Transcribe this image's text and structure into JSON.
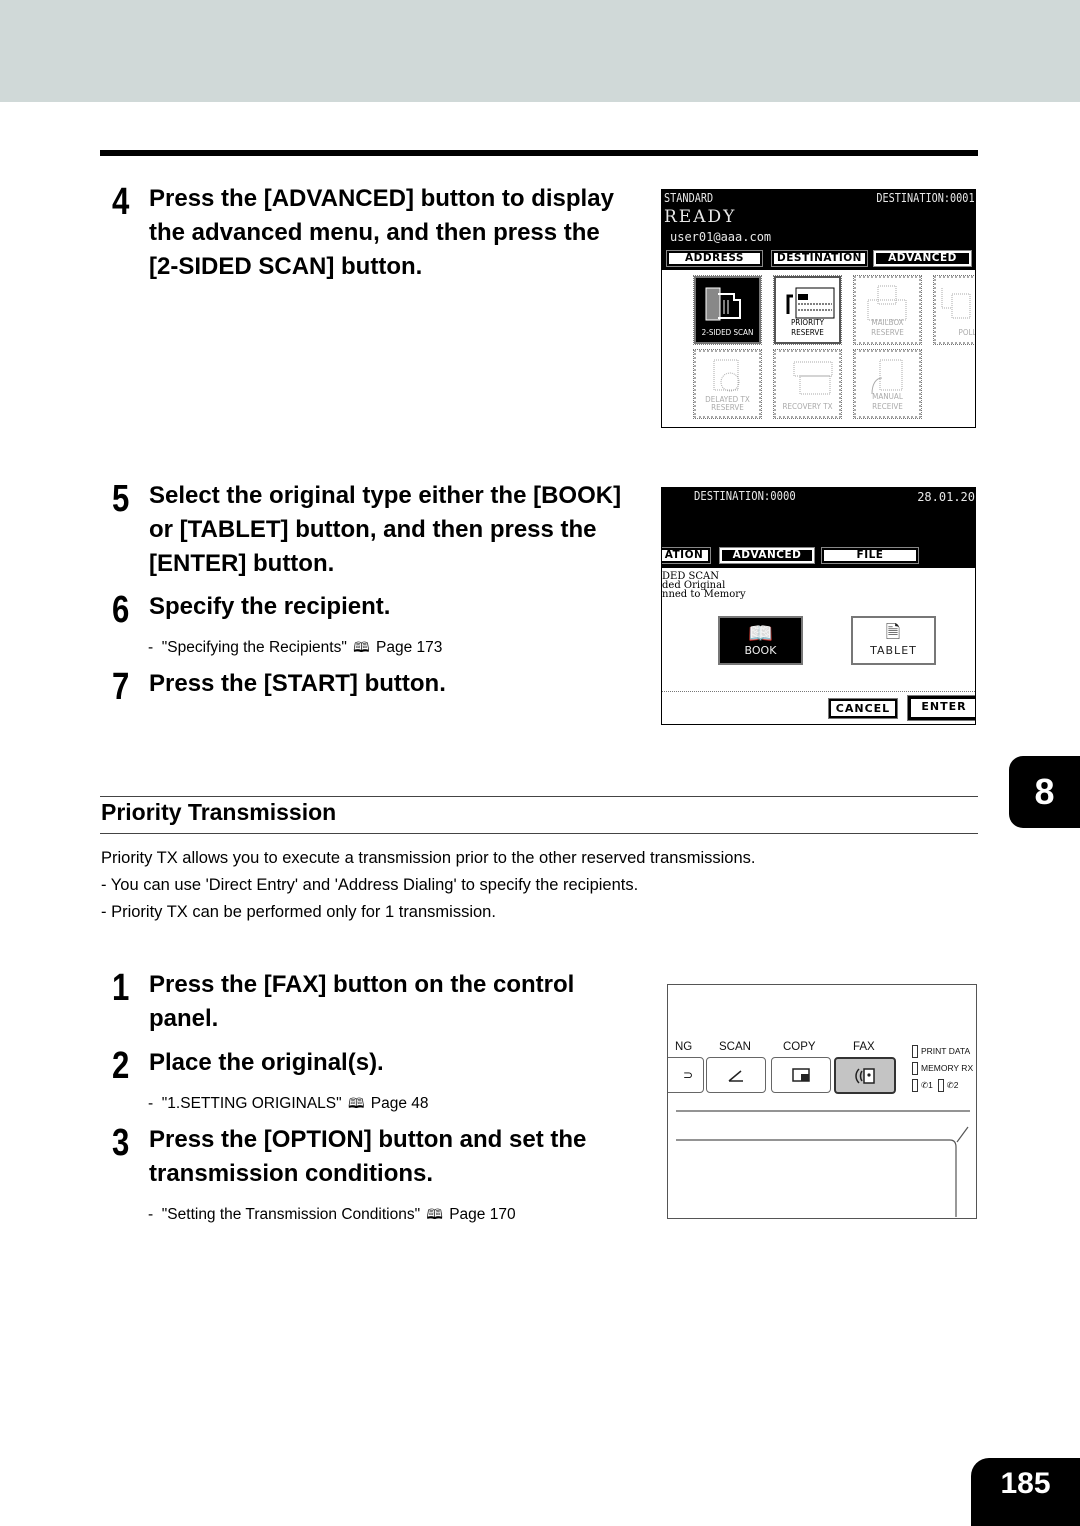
{
  "steps_top": [
    {
      "num": "4",
      "lines": [
        "Press the [ADVANCED] button to display",
        "the advanced menu, and then press the",
        "[2-SIDED SCAN] button."
      ]
    },
    {
      "num": "5",
      "lines": [
        "Select the original type either the [BOOK]",
        "or [TABLET] button, and then press the",
        "[ENTER] button."
      ]
    },
    {
      "num": "6",
      "lines": [
        "Specify the recipient."
      ],
      "ref": {
        "text": "\"Specifying the Recipients\"",
        "page": "Page 173"
      }
    },
    {
      "num": "7",
      "lines": [
        "Press the [START] button."
      ]
    }
  ],
  "screen1": {
    "mode": "STANDARD",
    "destination": "DESTINATION:0001",
    "status": "READY",
    "user": "user01@aaa.com",
    "tabs": [
      "ADDRESS",
      "DESTINATION",
      "ADVANCED"
    ],
    "active_tab": "ADVANCED",
    "functions": [
      {
        "label": "2-SIDED SCAN",
        "icon": "two-sided-scan-icon",
        "state": "active"
      },
      {
        "label": "PRIORITY RESERVE",
        "icon": "priority-reserve-icon",
        "state": "normal"
      },
      {
        "label": "MAILBOX RESERVE",
        "icon": "mailbox-icon",
        "state": "disabled"
      },
      {
        "label": "POLL",
        "icon": "poll-icon",
        "state": "disabled"
      },
      {
        "label": "DELAYED TX RESERVE",
        "icon": "delayed-tx-icon",
        "state": "disabled"
      },
      {
        "label": "RECOVERY TX",
        "icon": "recovery-tx-icon",
        "state": "disabled"
      },
      {
        "label": "MANUAL RECEIVE",
        "icon": "manual-receive-icon",
        "state": "disabled"
      }
    ]
  },
  "screen2": {
    "destination": "DESTINATION:0000",
    "date": "28.01.20",
    "tabs": [
      "ATION",
      "ADVANCED",
      "FILE"
    ],
    "info_lines": [
      "DED SCAN",
      "ded Original",
      "nned to Memory"
    ],
    "options": [
      {
        "label": "BOOK",
        "state": "active"
      },
      {
        "label": "TABLET",
        "state": "normal"
      }
    ],
    "cancel_label": "CANCEL",
    "enter_label": "ENTER"
  },
  "section": {
    "title": "Priority Transmission",
    "intro": "Priority TX allows you to execute a transmission prior to the other reserved transmissions.",
    "bullets": [
      "-  You can use 'Direct Entry' and 'Address Dialing' to specify the recipients.",
      "-  Priority TX can be performed only for 1 transmission."
    ]
  },
  "steps_bottom": [
    {
      "num": "1",
      "lines": [
        "Press the [FAX] button on the control",
        "panel."
      ]
    },
    {
      "num": "2",
      "lines": [
        "Place the original(s)."
      ],
      "ref": {
        "text": "\"1.SETTING ORIGINALS\"",
        "page": "Page 48"
      }
    },
    {
      "num": "3",
      "lines": [
        "Press the [OPTION] button and set the",
        "transmission conditions."
      ],
      "ref": {
        "text": "\"Setting the Transmission Conditions\"",
        "page": "Page 170"
      }
    }
  ],
  "control_panel": {
    "modes": [
      {
        "label": "NG",
        "icon": "printing-icon"
      },
      {
        "label": "SCAN",
        "icon": "scan-icon"
      },
      {
        "label": "COPY",
        "icon": "copy-icon"
      },
      {
        "label": "FAX",
        "icon": "fax-icon",
        "active": true
      }
    ],
    "indicators": [
      "PRINT DATA",
      "MEMORY RX",
      "1",
      "2"
    ]
  },
  "chapter_tab": "8",
  "page_number": "185",
  "ref_dash": "-",
  "book_icon": "🕮"
}
